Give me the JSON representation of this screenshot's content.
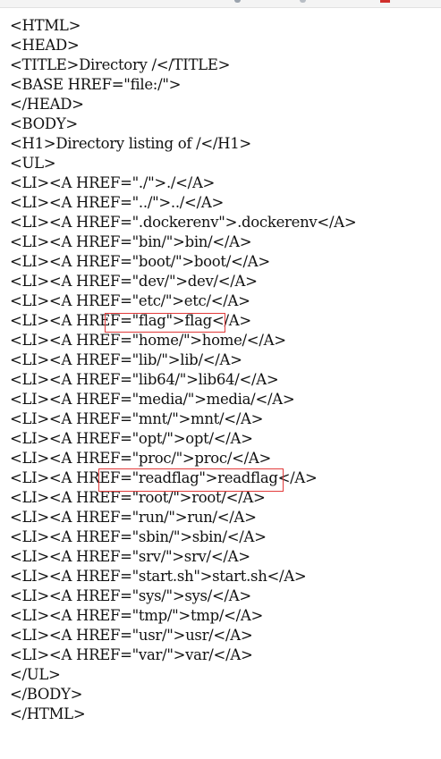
{
  "source_lines": [
    "<HTML>",
    "<HEAD>",
    "<TITLE>Directory /</TITLE>",
    "<BASE HREF=\"file:/\">",
    "</HEAD>",
    "<BODY>",
    "<H1>Directory listing of /</H1>",
    "<UL>",
    "<LI><A HREF=\"./\">./</A>",
    "<LI><A HREF=\"../\">../</A>",
    "<LI><A HREF=\".dockerenv\">.dockerenv</A>",
    "<LI><A HREF=\"bin/\">bin/</A>",
    "<LI><A HREF=\"boot/\">boot/</A>",
    "<LI><A HREF=\"dev/\">dev/</A>",
    "<LI><A HREF=\"etc/\">etc/</A>",
    "<LI><A HREF=\"flag\">flag</A>",
    "<LI><A HREF=\"home/\">home/</A>",
    "<LI><A HREF=\"lib/\">lib/</A>",
    "<LI><A HREF=\"lib64/\">lib64/</A>",
    "<LI><A HREF=\"media/\">media/</A>",
    "<LI><A HREF=\"mnt/\">mnt/</A>",
    "<LI><A HREF=\"opt/\">opt/</A>",
    "<LI><A HREF=\"proc/\">proc/</A>",
    "<LI><A HREF=\"readflag\">readflag</A>",
    "<LI><A HREF=\"root/\">root/</A>",
    "<LI><A HREF=\"run/\">run/</A>",
    "<LI><A HREF=\"sbin/\">sbin/</A>",
    "<LI><A HREF=\"srv/\">srv/</A>",
    "<LI><A HREF=\"start.sh\">start.sh</A>",
    "<LI><A HREF=\"sys/\">sys/</A>",
    "<LI><A HREF=\"tmp/\">tmp/</A>",
    "<LI><A HREF=\"usr/\">usr/</A>",
    "<LI><A HREF=\"var/\">var/</A>",
    "</UL>",
    "</BODY>",
    "</HTML>"
  ],
  "colors": {
    "highlight": "#e23b3b",
    "text": "#111111",
    "background": "#ffffff"
  }
}
